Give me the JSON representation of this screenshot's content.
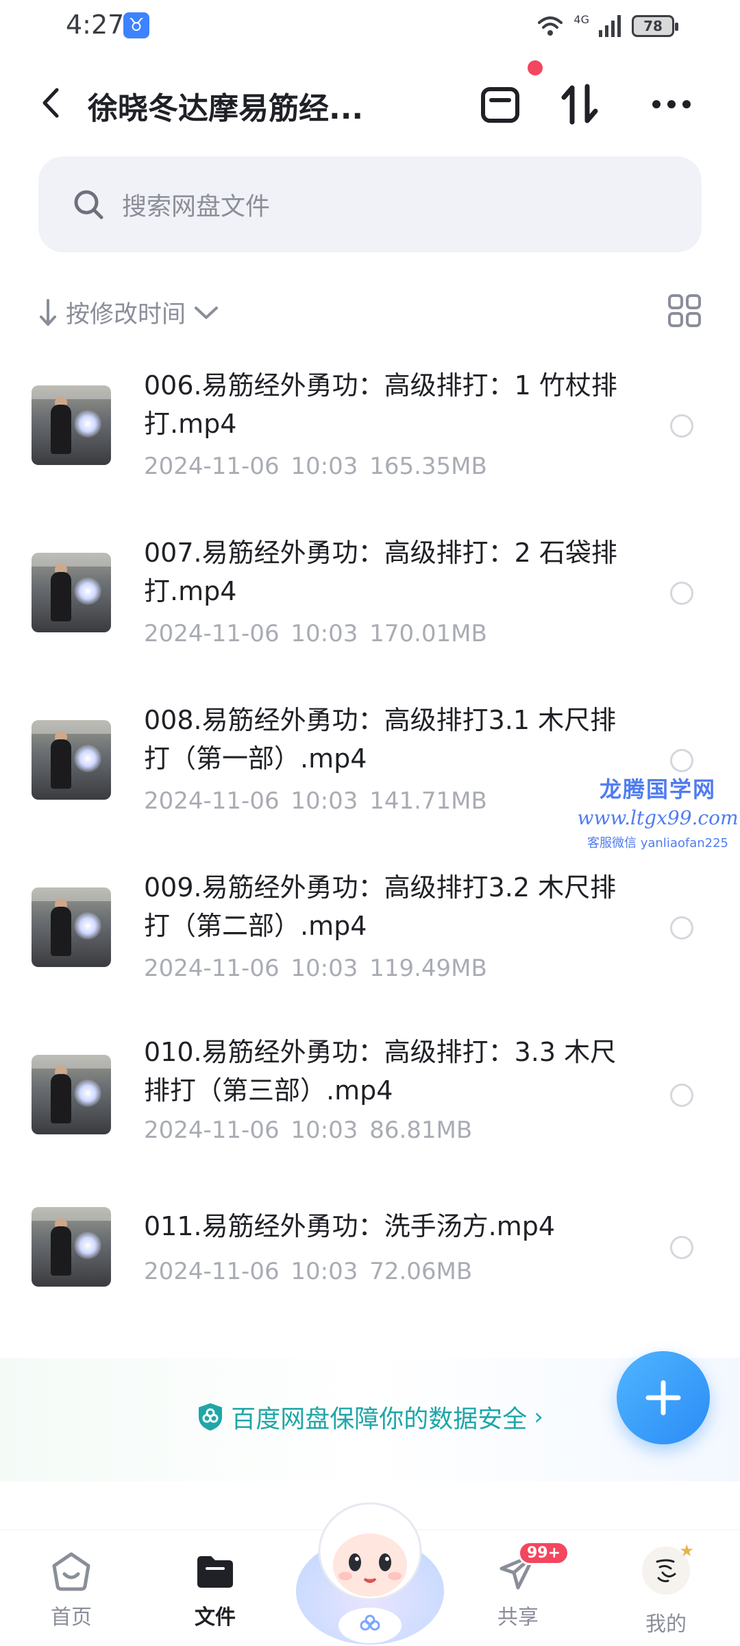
{
  "status_bar": {
    "time": "4:27",
    "app_badge": "♉",
    "network": "4G",
    "battery": "78"
  },
  "header": {
    "title": "徐晓冬达摩易筋经..."
  },
  "search": {
    "placeholder": "搜索网盘文件"
  },
  "sort": {
    "label": "按修改时间"
  },
  "files": [
    {
      "name": "006.易筋经外勇功：高级排打：1 竹杖排打.mp4",
      "date": "2024-11-06",
      "time": "10:03",
      "size": "165.35MB"
    },
    {
      "name": "007.易筋经外勇功：高级排打：2 石袋排打.mp4",
      "date": "2024-11-06",
      "time": "10:03",
      "size": "170.01MB"
    },
    {
      "name": "008.易筋经外勇功：高级排打3.1 木尺排打（第一部）.mp4",
      "date": "2024-11-06",
      "time": "10:03",
      "size": "141.71MB"
    },
    {
      "name": "009.易筋经外勇功：高级排打3.2 木尺排打（第二部）.mp4",
      "date": "2024-11-06",
      "time": "10:03",
      "size": "119.49MB"
    },
    {
      "name": "010.易筋经外勇功：高级排打：3.3 木尺排打（第三部）.mp4",
      "date": "2024-11-06",
      "time": "10:03",
      "size": "86.81MB"
    },
    {
      "name": "011.易筋经外勇功：洗手汤方.mp4",
      "date": "2024-11-06",
      "time": "10:03",
      "size": "72.06MB"
    }
  ],
  "watermark": {
    "title": "龙腾国学网",
    "url": "www.ltgx99.com",
    "contact": "客服微信 yanliaofan225"
  },
  "security_banner": {
    "text": "百度网盘保障你的数据安全",
    "arrow": "›"
  },
  "bottom_nav": {
    "home": "首页",
    "files": "文件",
    "share": "共享",
    "share_badge": "99+",
    "me": "我的"
  },
  "colors": {
    "accent": "#2b8cf6",
    "badge": "#f4465e",
    "security": "#1fa6a8"
  }
}
